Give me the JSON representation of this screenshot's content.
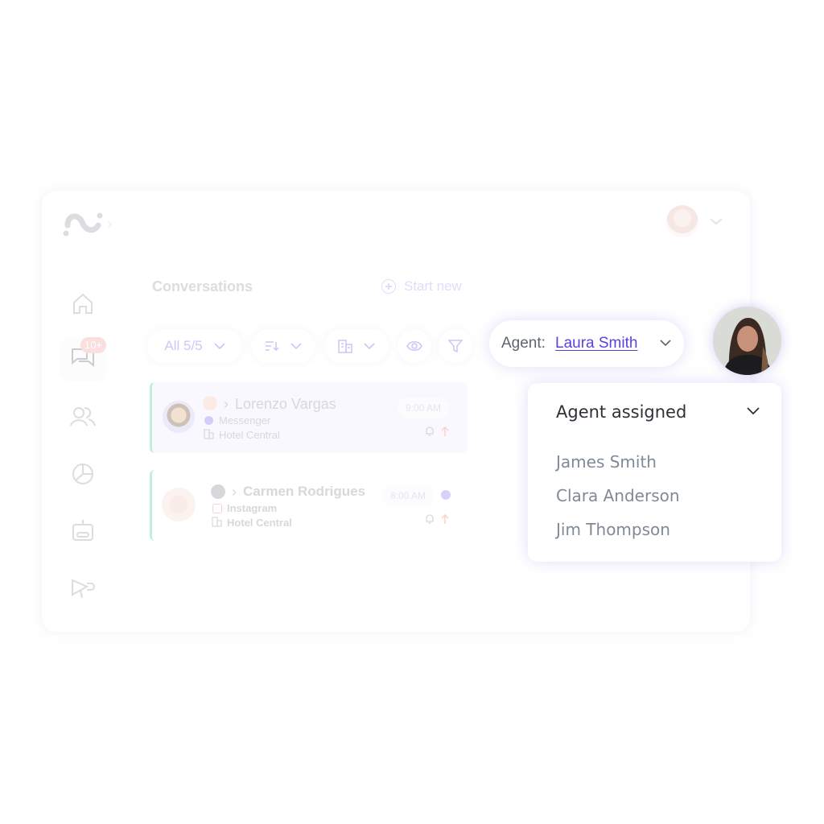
{
  "header": {
    "logo": "brand-logo",
    "logo_chevron": "›",
    "user_menu": "user-avatar"
  },
  "sidebar": {
    "items": [
      {
        "icon": "home-icon",
        "label": "Home"
      },
      {
        "icon": "chat-icon",
        "label": "Conversations",
        "badge": "10+",
        "active": true
      },
      {
        "icon": "users-icon",
        "label": "Contacts"
      },
      {
        "icon": "pie-chart-icon",
        "label": "Reports"
      },
      {
        "icon": "bot-icon",
        "label": "Bots"
      },
      {
        "icon": "megaphone-icon",
        "label": "Campaigns"
      }
    ]
  },
  "main": {
    "title": "Conversations",
    "start_new_label": "Start new",
    "filters": {
      "all_label": "All 5/5",
      "sort_icon": "sort-icon",
      "building_icon": "building-icon",
      "eye_icon": "eye-icon",
      "filter_icon": "filter-icon"
    },
    "conversations": [
      {
        "name": "Lorenzo Vargas",
        "channel": "Messenger",
        "location": "Hotel Central",
        "time": "9:00 AM",
        "unread": false
      },
      {
        "name": "Carmen Rodrigues",
        "channel": "Instagram",
        "location": "Hotel Central",
        "time": "8:00 AM",
        "unread": true
      }
    ]
  },
  "agent_selector": {
    "label": "Agent:",
    "selected": "Laura Smith"
  },
  "agent_dropdown": {
    "title": "Agent assigned",
    "options": [
      "James Smith",
      "Clara Anderson",
      "Jim Thompson"
    ]
  },
  "colors": {
    "accent": "#5b3fe0",
    "badge": "#f4a3a3",
    "active_border": "#4ad39a"
  }
}
